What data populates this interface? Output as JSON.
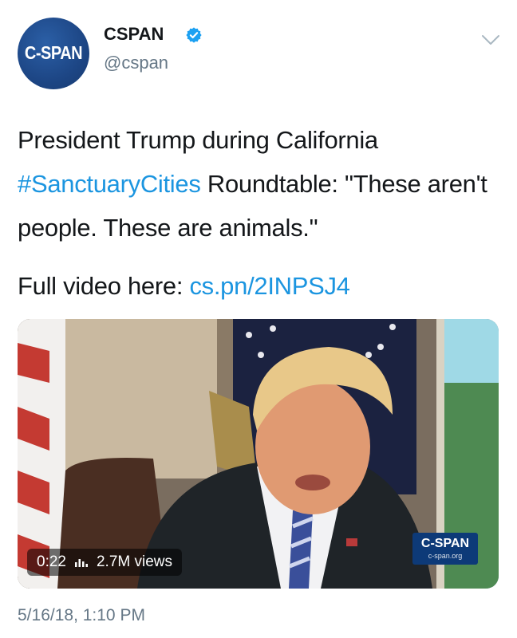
{
  "author": {
    "avatar_text": "C-SPAN",
    "display_name": "CSPAN",
    "handle": "@cspan",
    "verified": true
  },
  "tweet": {
    "line_1_prefix": "President Trump during California",
    "hashtag": "#SanctuaryCities",
    "line_2_rest": " Roundtable: \"These aren't people. These are animals.\"",
    "video_label": "Full video here: ",
    "video_link": "cs.pn/2INPSJ4"
  },
  "media": {
    "duration": "0:22",
    "views": "2.7M views",
    "watermark_title": "C-SPAN",
    "watermark_url": "c-span.org"
  },
  "timestamp": "5/16/18, 1:10 PM",
  "colors": {
    "link": "#1b95e0",
    "verified": "#1da1f2",
    "muted": "#657786"
  },
  "icons": [
    "verified-badge-icon",
    "chevron-down-icon",
    "views-bars-icon"
  ]
}
